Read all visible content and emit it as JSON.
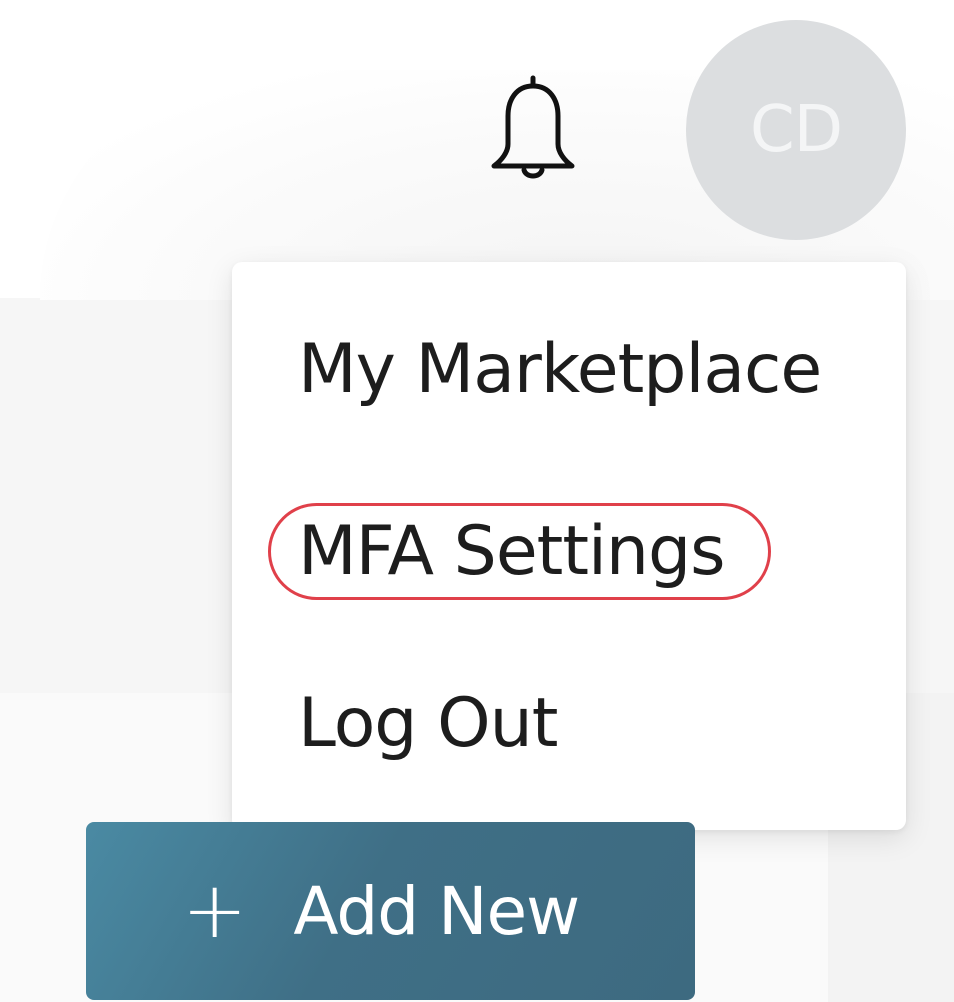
{
  "header": {
    "avatar_initials": "CD"
  },
  "menu": {
    "items": [
      {
        "label": "My Marketplace"
      },
      {
        "label": "MFA Settings"
      },
      {
        "label": "Log Out"
      }
    ]
  },
  "actions": {
    "add_new_label": "Add New",
    "add_new_icon": "+"
  },
  "colors": {
    "avatar_bg": "#dcdee0",
    "button_bg": "#3f6f86",
    "highlight": "#e0404a"
  },
  "icons": {
    "notifications": "bell-icon",
    "add": "plus-icon"
  }
}
